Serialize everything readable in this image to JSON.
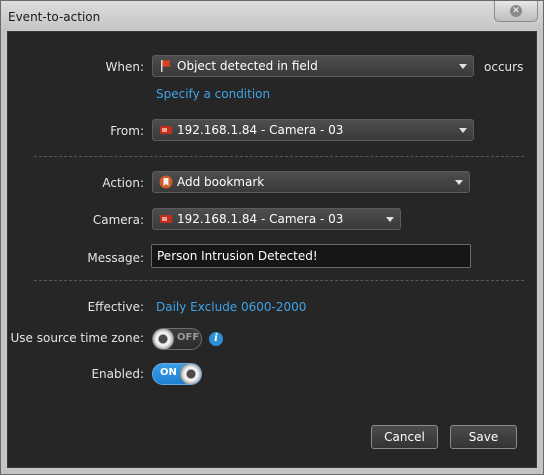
{
  "window": {
    "title": "Event-to-action"
  },
  "rule": {
    "when_label": "When:",
    "when_value": "Object detected in field",
    "when_suffix": "occurs",
    "condition_link": "Specify a condition",
    "from_label": "From:",
    "from_value": "192.168.1.84 - Camera - 03",
    "action_label": "Action:",
    "action_value": "Add bookmark",
    "camera_label": "Camera:",
    "camera_value": "192.168.1.84 - Camera - 03",
    "message_label": "Message:",
    "message_value": "Person Intrusion Detected!",
    "effective_label": "Effective:",
    "effective_value": "Daily Exclude 0600-2000",
    "source_tz_label": "Use source time zone:",
    "source_tz_state": "OFF",
    "enabled_label": "Enabled:",
    "enabled_state": "ON"
  },
  "buttons": {
    "cancel": "Cancel",
    "save": "Save"
  },
  "colors": {
    "link": "#3fa4e8",
    "toggle_on": "#2a8fe0",
    "flag": "#e0401e"
  }
}
